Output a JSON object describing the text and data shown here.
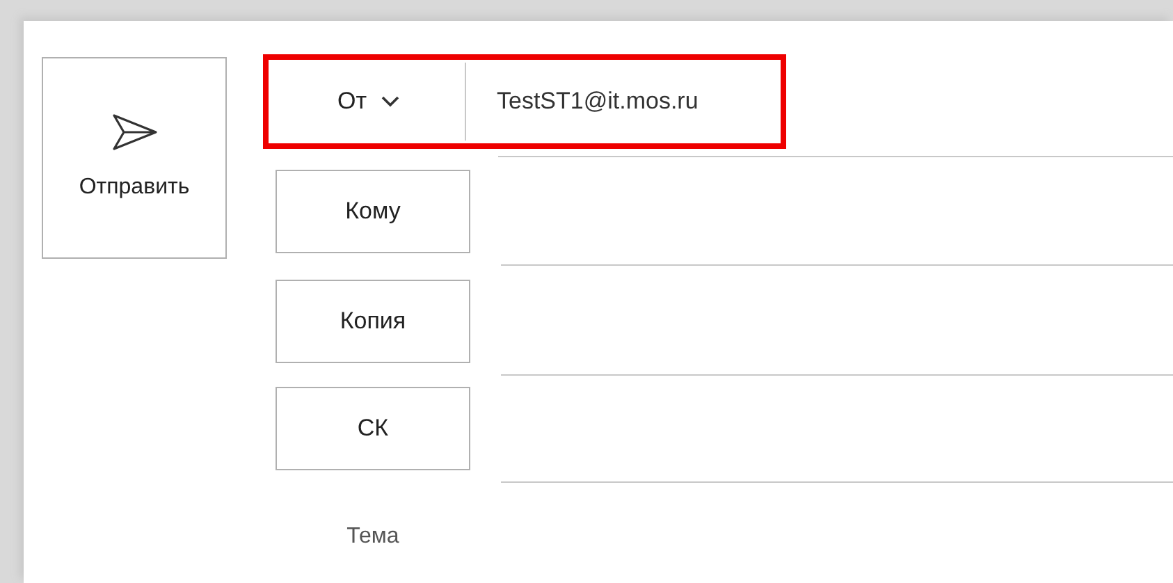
{
  "send_button": {
    "label": "Отправить"
  },
  "from": {
    "label": "От",
    "value": "TestST1@it.mos.ru",
    "highlighted": true
  },
  "recipients": [
    {
      "label": "Кому"
    },
    {
      "label": "Копия"
    },
    {
      "label": "СК"
    }
  ],
  "subject": {
    "label": "Тема"
  }
}
